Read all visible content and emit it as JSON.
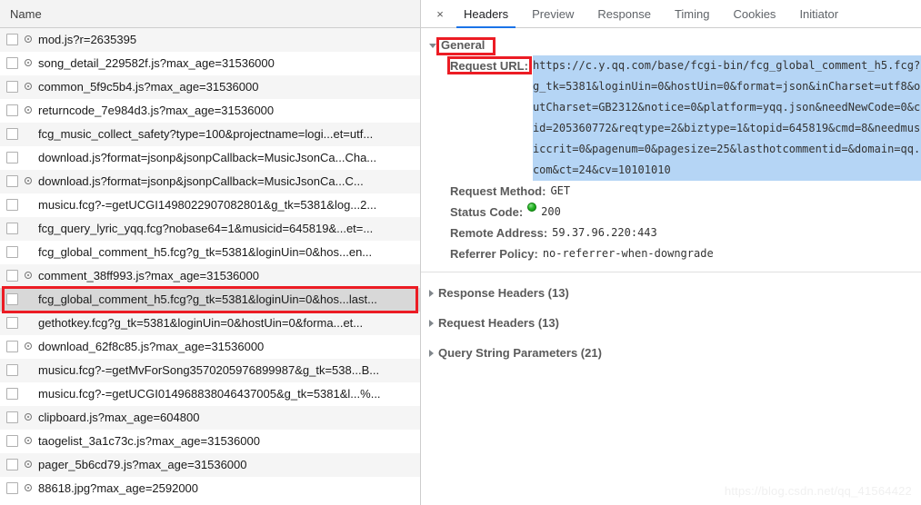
{
  "left_panel": {
    "column_header": "Name",
    "rows": [
      {
        "label": "mod.js?r=2635395",
        "icon": "js-file-icon"
      },
      {
        "label": "song_detail_229582f.js?max_age=31536000",
        "icon": "js-file-icon"
      },
      {
        "label": "common_5f9c5b4.js?max_age=31536000",
        "icon": "js-file-icon"
      },
      {
        "label": "returncode_7e984d3.js?max_age=31536000",
        "icon": "js-file-icon"
      },
      {
        "label": "fcg_music_collect_safety?type=100&projectname=logi...et=utf...",
        "icon": "none"
      },
      {
        "label": "download.js?format=jsonp&jsonpCallback=MusicJsonCa...Cha...",
        "icon": "none"
      },
      {
        "label": "download.js?format=jsonp&jsonpCallback=MusicJsonCa...C...",
        "icon": "js-file-icon"
      },
      {
        "label": "musicu.fcg?-=getUCGI1498022907082801&g_tk=5381&log...2...",
        "icon": "none"
      },
      {
        "label": "fcg_query_lyric_yqq.fcg?nobase64=1&musicid=645819&...et=...",
        "icon": "none"
      },
      {
        "label": "fcg_global_comment_h5.fcg?g_tk=5381&loginUin=0&hos...en...",
        "icon": "none"
      },
      {
        "label": "comment_38ff993.js?max_age=31536000",
        "icon": "js-file-icon"
      },
      {
        "label": "fcg_global_comment_h5.fcg?g_tk=5381&loginUin=0&hos...last...",
        "icon": "none",
        "selected": true
      },
      {
        "label": "gethotkey.fcg?g_tk=5381&loginUin=0&hostUin=0&forma...et...",
        "icon": "none"
      },
      {
        "label": "download_62f8c85.js?max_age=31536000",
        "icon": "js-file-icon"
      },
      {
        "label": "musicu.fcg?-=getMvForSong3570205976899987&g_tk=538...B...",
        "icon": "none"
      },
      {
        "label": "musicu.fcg?-=getUCGI014968838046437005&g_tk=5381&l...%...",
        "icon": "none"
      },
      {
        "label": "clipboard.js?max_age=604800",
        "icon": "js-file-icon"
      },
      {
        "label": "taogelist_3a1c73c.js?max_age=31536000",
        "icon": "js-file-icon"
      },
      {
        "label": "pager_5b6cd79.js?max_age=31536000",
        "icon": "js-file-icon"
      },
      {
        "label": "88618.jpg?max_age=2592000",
        "icon": "js-file-icon"
      }
    ]
  },
  "right_panel": {
    "close_label": "×",
    "tabs": [
      {
        "label": "Headers",
        "active": true
      },
      {
        "label": "Preview",
        "active": false
      },
      {
        "label": "Response",
        "active": false
      },
      {
        "label": "Timing",
        "active": false
      },
      {
        "label": "Cookies",
        "active": false
      },
      {
        "label": "Initiator",
        "active": false
      }
    ],
    "general": {
      "title": "General",
      "request_url_key": "Request URL:",
      "request_url_value": "https://c.y.qq.com/base/fcgi-bin/fcg_global_comment_h5.fcg?g_tk=5381&loginUin=0&hostUin=0&format=json&inCharset=utf8&outCharset=GB2312&notice=0&platform=yqq.json&needNewCode=0&cid=205360772&reqtype=2&biztype=1&topid=645819&cmd=8&needmusiccrit=0&pagenum=0&pagesize=25&lasthotcommentid=&domain=qq.com&ct=24&cv=10101010",
      "request_method_key": "Request Method:",
      "request_method_value": "GET",
      "status_code_key": "Status Code:",
      "status_code_value": "200",
      "remote_address_key": "Remote Address:",
      "remote_address_value": "59.37.96.220:443",
      "referrer_policy_key": "Referrer Policy:",
      "referrer_policy_value": "no-referrer-when-downgrade"
    },
    "collapsed_sections": [
      {
        "label": "Response Headers (13)"
      },
      {
        "label": "Request Headers (13)"
      },
      {
        "label": "Query String Parameters (21)"
      }
    ]
  },
  "watermark": "https://blog.csdn.net/qq_41564422",
  "colors": {
    "annotation_red": "#ec1c24",
    "tab_accent_blue": "#1a73e8",
    "selection_blue": "#b5d5f5",
    "status_green": "#27b527"
  }
}
